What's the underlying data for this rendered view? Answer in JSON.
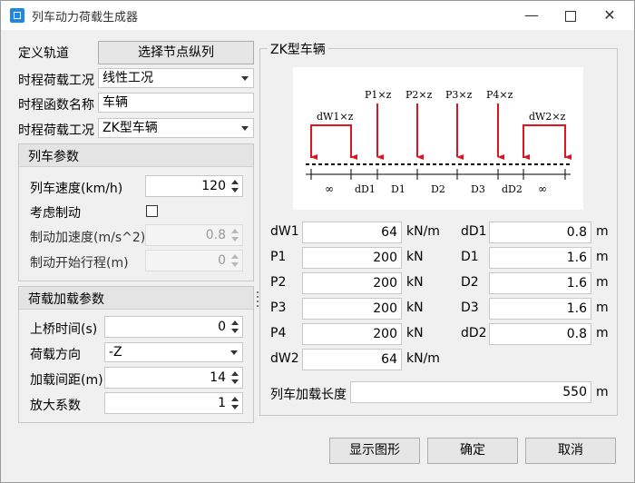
{
  "window": {
    "title": "列车动力荷载生成器"
  },
  "left": {
    "track_label": "定义轨道",
    "select_nodes_button": "选择节点纵列",
    "load_case_label": "时程荷载工况",
    "load_case_value": "线性工况",
    "func_name_label": "时程函数名称",
    "func_name_value": "车辆",
    "vehicle_case_label": "时程荷载工况",
    "vehicle_case_value": "ZK型车辆",
    "train_params": {
      "header": "列车参数",
      "speed_label": "列车速度(km/h)",
      "speed_value": "120",
      "braking_label": "考虑制动",
      "brake_accel_label": "制动加速度(m/s^2)",
      "brake_accel_value": "0.8",
      "brake_start_label": "制动开始行程(m)",
      "brake_start_value": "0"
    },
    "load_params": {
      "header": "荷载加载参数",
      "time_label": "上桥时间(s)",
      "time_value": "0",
      "direction_label": "荷载方向",
      "direction_value": "-Z",
      "spacing_label": "加载间距(m)",
      "spacing_value": "14",
      "factor_label": "放大系数",
      "factor_value": "1"
    }
  },
  "right": {
    "legend": "ZK型车辆",
    "diagram": {
      "p_labels": [
        "P1×z",
        "P2×z",
        "P3×z",
        "P4×z"
      ],
      "w1_label": "dW1×z",
      "w2_label": "dW2×z",
      "dim_labels": [
        "∞",
        "dD1",
        "D1",
        "D2",
        "D3",
        "dD2",
        "∞"
      ]
    },
    "params_left": [
      {
        "label": "dW1",
        "value": "64",
        "unit": "kN/m"
      },
      {
        "label": "P1",
        "value": "200",
        "unit": "kN"
      },
      {
        "label": "P2",
        "value": "200",
        "unit": "kN"
      },
      {
        "label": "P3",
        "value": "200",
        "unit": "kN"
      },
      {
        "label": "P4",
        "value": "200",
        "unit": "kN"
      },
      {
        "label": "dW2",
        "value": "64",
        "unit": "kN/m"
      }
    ],
    "params_right": [
      {
        "label": "dD1",
        "value": "0.8",
        "unit": "m"
      },
      {
        "label": "D1",
        "value": "1.6",
        "unit": "m"
      },
      {
        "label": "D2",
        "value": "1.6",
        "unit": "m"
      },
      {
        "label": "D3",
        "value": "1.6",
        "unit": "m"
      },
      {
        "label": "dD2",
        "value": "0.8",
        "unit": "m"
      }
    ],
    "train_length": {
      "label": "列车加载长度",
      "value": "550",
      "unit": "m"
    }
  },
  "footer": {
    "show_button": "显示图形",
    "ok_button": "确定",
    "cancel_button": "取消"
  },
  "colors": {
    "arrow": "#e0141e",
    "titlebar": "#ffffff",
    "accent": "#1e88e5"
  }
}
